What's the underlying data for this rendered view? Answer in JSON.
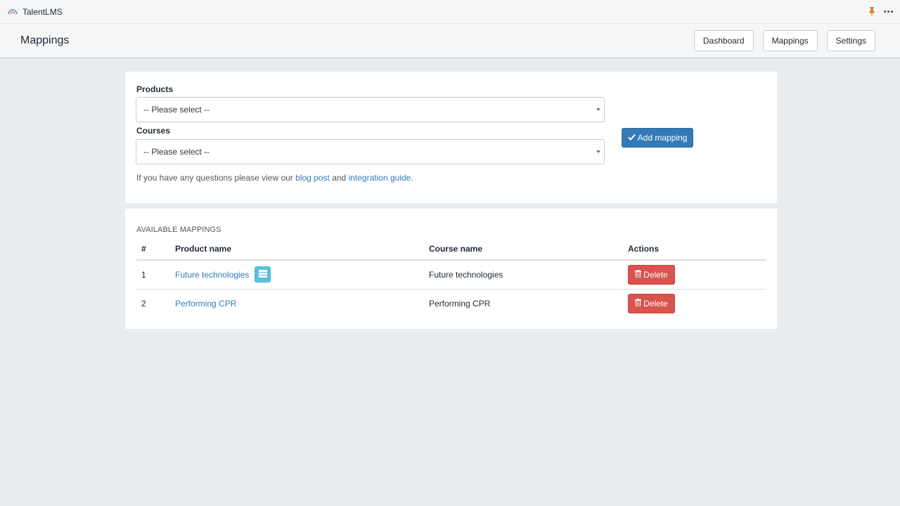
{
  "app": {
    "title": "TalentLMS",
    "logo_icon": "talentlms-logo-icon",
    "pin_icon": "pin-icon",
    "more_icon": "more-icon"
  },
  "header": {
    "title": "Mappings",
    "nav": [
      {
        "label": "Dashboard"
      },
      {
        "label": "Mappings"
      },
      {
        "label": "Settings"
      }
    ]
  },
  "form": {
    "products_label": "Products",
    "products_value": "-- Please select --",
    "courses_label": "Courses",
    "courses_value": "-- Please select --",
    "add_button_label": "Add mapping",
    "help_prefix": "If you have any questions please view our",
    "help_link1": "blog post",
    "help_middle": "and",
    "help_link2": "integration guide",
    "help_suffix": "."
  },
  "mappings": {
    "section_title": "AVAILABLE MAPPINGS",
    "columns": [
      "#",
      "Product name",
      "Course name",
      "Actions"
    ],
    "rows": [
      {
        "num": "1",
        "product": "Future technologies",
        "course": "Future technologies",
        "action": "Delete",
        "has_variants": true
      },
      {
        "num": "2",
        "product": "Performing CPR",
        "course": "Performing CPR",
        "action": "Delete",
        "has_variants": false
      }
    ]
  },
  "colors": {
    "primary": "#337ab7",
    "danger": "#d9534f",
    "info": "#5bc0de",
    "background": "#e9ecef"
  }
}
